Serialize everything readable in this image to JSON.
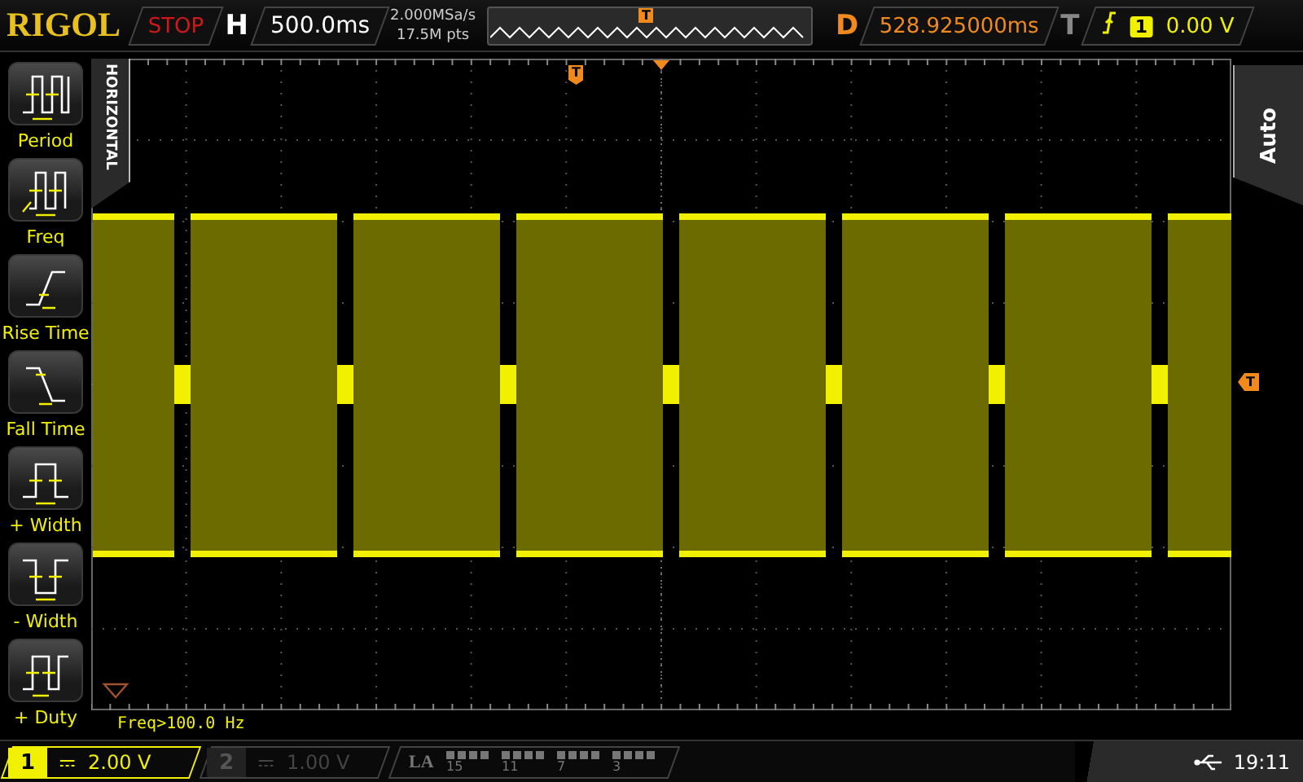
{
  "top_bar": {
    "brand": "RIGOL",
    "run_state": "STOP",
    "timebase_label": "H",
    "timebase": "500.0ms",
    "sample_rate": "2.000MSa/s",
    "memory_depth": "17.5M pts",
    "overview_marker": "T",
    "delay_label": "D",
    "delay": "528.925000ms",
    "trigger_label": "T",
    "trigger_source": "1",
    "trigger_level": "0.00 V"
  },
  "sidebar": {
    "tab": "HORIZONTAL",
    "items": [
      {
        "kind": "period",
        "label": "Period"
      },
      {
        "kind": "freq",
        "label": "Freq"
      },
      {
        "kind": "rise",
        "label": "Rise Time"
      },
      {
        "kind": "fall",
        "label": "Fall Time"
      },
      {
        "kind": "pwidth",
        "label": "+ Width"
      },
      {
        "kind": "nwidth",
        "label": "- Width"
      },
      {
        "kind": "duty",
        "label": "+ Duty"
      }
    ]
  },
  "screen": {
    "trigger_position_marker": "T",
    "trigger_level_marker": "T",
    "measurement": "Freq>100.0 Hz"
  },
  "right_panel": {
    "tab": "Auto"
  },
  "bottom_bar": {
    "channels": [
      {
        "number": "1",
        "scale": "2.00 V",
        "on": true
      },
      {
        "number": "2",
        "scale": "1.00 V",
        "on": false
      }
    ],
    "la": {
      "label": "LA",
      "groups": [
        "15",
        "11",
        "7",
        "3"
      ]
    },
    "time": "19:11"
  }
}
